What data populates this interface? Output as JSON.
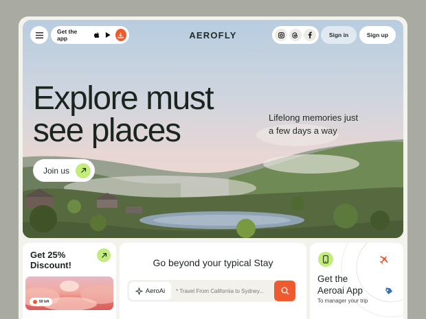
{
  "header": {
    "brand": "AEROFLY",
    "get_app_label": "Get the app",
    "signin_label": "Sign in",
    "signup_label": "Sign up",
    "icons": [
      "menu-icon",
      "apple-icon",
      "play-store-icon",
      "download-icon",
      "instagram-icon",
      "threads-icon",
      "facebook-icon"
    ]
  },
  "hero": {
    "headline_line1": "Explore must",
    "headline_line2": "see places",
    "subtitle_line1": "Lifelong memories just",
    "subtitle_line2": "a few days a way",
    "cta_label": "Join us"
  },
  "discount_card": {
    "title_line1": "Get 25%",
    "title_line2": "Discount!",
    "badge_text": "50 left"
  },
  "stay_card": {
    "title": "Go beyond your typical Stay",
    "ai_label": "AeroAi",
    "search_placeholder": "* Travel From California to Sydney..."
  },
  "app_card": {
    "title_line1": "Get the",
    "title_line2": "Aeroai App",
    "subtitle": "To manager your trip"
  },
  "colors": {
    "accent_green": "#c3ec7c",
    "accent_orange": "#ef5a2f",
    "text_dark": "#1a2520",
    "page_bg": "#a9aaa2"
  }
}
